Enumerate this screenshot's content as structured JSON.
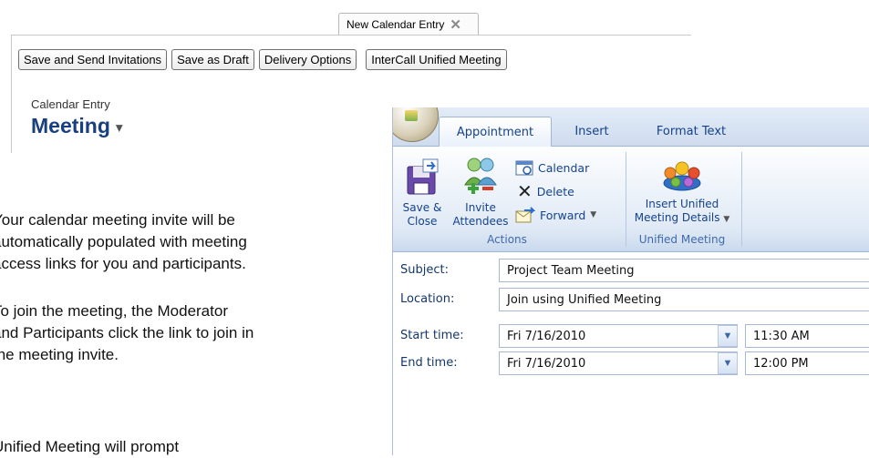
{
  "notes": {
    "tab_title": "New Calendar Entry",
    "buttons": [
      "Save and Send Invitations",
      "Save as Draft",
      "Delivery Options",
      "InterCall Unified Meeting"
    ],
    "entry_type_label": "Calendar Entry",
    "entry_kind": "Meeting",
    "caret": "▾"
  },
  "instructions": {
    "paragraph1": [
      "Your calendar meeting invite will be",
      "automatically populated with meeting",
      "access links for you and participants."
    ],
    "paragraph2": [
      "To join the meeting, the Moderator",
      "and Participants click the link to join in",
      "the meeting invite."
    ],
    "paragraph3": [
      "Unified Meeting will prompt"
    ]
  },
  "outlook": {
    "tabs": [
      "Appointment",
      "Insert",
      "Format Text"
    ],
    "actions": {
      "save_close": [
        "Save &",
        "Close"
      ],
      "invite": [
        "Invite",
        "Attendees"
      ],
      "calendar": "Calendar",
      "delete": "Delete",
      "forward": "Forward",
      "group_label": "Actions"
    },
    "unified": {
      "insert": [
        "Insert Unified",
        "Meeting Details"
      ],
      "group_label": "Unified Meeting"
    },
    "form": {
      "subject_label": "Subject:",
      "subject_value": "Project Team Meeting",
      "location_label": "Location:",
      "location_value": "Join using Unified Meeting",
      "start_label": "Start time:",
      "start_date": "Fri 7/16/2010",
      "start_time": "11:30 AM",
      "end_label": "End time:",
      "end_date": "Fri 7/16/2010",
      "end_time": "12:00 PM"
    }
  },
  "colors": {
    "notes_heading": "#18407e",
    "ribbon_text": "#15428b",
    "group_label": "#3e6aaa"
  }
}
